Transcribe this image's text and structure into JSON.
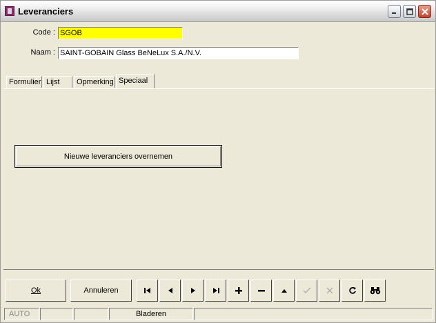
{
  "window": {
    "title": "Leveranciers"
  },
  "form": {
    "code_label": "Code :",
    "code_value": "SGOB",
    "naam_label": "Naam :",
    "naam_value": "SAINT-GOBAIN Glass BeNeLux S.A./N.V."
  },
  "tabs": [
    "Formulier",
    "Lijst",
    "Opmerking",
    "Speciaal"
  ],
  "active_tab": "Speciaal",
  "panel": {
    "action_button": "Nieuwe leveranciers overnemen"
  },
  "toolbar": {
    "ok_label": "Ok",
    "annuleren_label": "Annuleren"
  },
  "statusbar": {
    "mode": "AUTO",
    "cell2": "",
    "cell3": "",
    "state": "Bladeren"
  },
  "colors": {
    "code_field_bg": "#ffff00",
    "window_bg": "#ece9d8"
  }
}
